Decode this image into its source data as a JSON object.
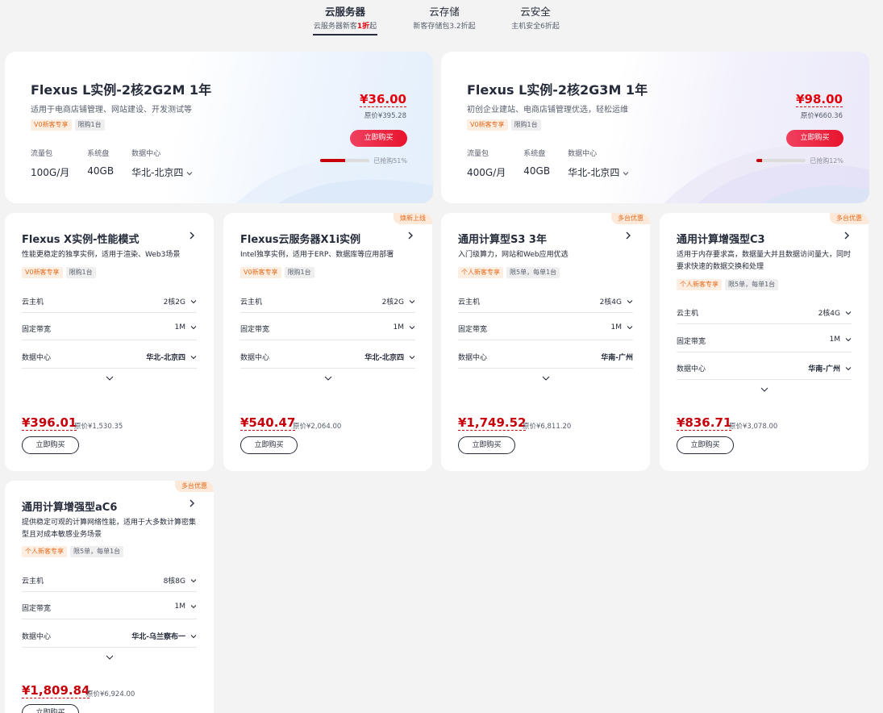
{
  "tabs": [
    {
      "title": "云服务器",
      "sub_pre": "云服务器新客",
      "sub_hl": "1折",
      "sub_post": "起"
    },
    {
      "title": "云存储",
      "sub_pre": "新客存储包3.2折起",
      "sub_hl": "",
      "sub_post": ""
    },
    {
      "title": "云安全",
      "sub_pre": "主机安全6折起",
      "sub_hl": "",
      "sub_post": ""
    }
  ],
  "featured": [
    {
      "title": "Flexus L实例-2核2G2M 1年",
      "desc": "适用于电商店铺管理、网站建设、开发测试等",
      "tags": [
        "V0新客专享",
        "限购1台"
      ],
      "specs": [
        {
          "label": "流量包",
          "value": "100G/月"
        },
        {
          "label": "系统盘",
          "value": "40GB"
        },
        {
          "label": "数据中心",
          "value": "华北-北京四"
        }
      ],
      "price": "¥36.00",
      "original": "原价¥395.28",
      "buy": "立即购买",
      "sold_label": "已抢购51%",
      "sold_percent": 51
    },
    {
      "title": "Flexus L实例-2核2G3M 1年",
      "desc": "初创企业建站、电商店铺管理优选，轻松运维",
      "tags": [
        "V0新客专享",
        "限购1台"
      ],
      "specs": [
        {
          "label": "流量包",
          "value": "400G/月"
        },
        {
          "label": "系统盘",
          "value": "40GB"
        },
        {
          "label": "数据中心",
          "value": "华北-北京四"
        }
      ],
      "price": "¥98.00",
      "original": "原价¥660.36",
      "buy": "立即购买",
      "sold_label": "已抢购12%",
      "sold_percent": 12
    }
  ],
  "cards": [
    {
      "corner": "",
      "title": "Flexus X实例-性能模式",
      "desc": "性能更稳定的独享实例，适用于渲染、Web3场景",
      "tags": [
        "V0新客专享",
        "限购1台"
      ],
      "rows": [
        {
          "label": "云主机",
          "value": "2核2G"
        },
        {
          "label": "固定带宽",
          "value": "1M"
        },
        {
          "label": "数据中心",
          "value": "华北-北京四"
        }
      ],
      "price": "¥396.01",
      "original": "原价¥1,530.35",
      "buy": "立即购买"
    },
    {
      "corner": "焕新上线",
      "title": "Flexus云服务器X1i实例",
      "desc": "Intel独享实例，适用于ERP、数据库等应用部署",
      "tags": [
        "V0新客专享",
        "限购1台"
      ],
      "rows": [
        {
          "label": "云主机",
          "value": "2核2G"
        },
        {
          "label": "固定带宽",
          "value": "1M"
        },
        {
          "label": "数据中心",
          "value": "华北-北京四"
        }
      ],
      "price": "¥540.47",
      "original": "原价¥2,064.00",
      "buy": "立即购买"
    },
    {
      "corner": "多台优惠",
      "title": "通用计算型S3 3年",
      "desc": "入门级算力，网站和Web应用优选",
      "tags": [
        "个人新客专享",
        "限5单，每单1台"
      ],
      "rows": [
        {
          "label": "云主机",
          "value": "2核4G"
        },
        {
          "label": "固定带宽",
          "value": "1M"
        },
        {
          "label": "数据中心",
          "value": "华南-广州"
        }
      ],
      "price": "¥1,749.52",
      "original": "原价¥6,811.20",
      "buy": "立即购买"
    },
    {
      "corner": "多台优惠",
      "title": "通用计算增强型C3",
      "desc": "适用于内存要求高，数据量大并且数据访问量大，同时要求快速的数据交换和处理",
      "tags": [
        "个人新客专享",
        "限5单，每单1台"
      ],
      "rows": [
        {
          "label": "云主机",
          "value": "2核4G"
        },
        {
          "label": "固定带宽",
          "value": "1M"
        },
        {
          "label": "数据中心",
          "value": "华南-广州"
        }
      ],
      "price": "¥836.71",
      "original": "原价¥3,078.00",
      "buy": "立即购买"
    },
    {
      "corner": "多台优惠",
      "title": "通用计算增强型aC6",
      "desc": "提供稳定可观的计算网络性能，适用于大多数计算密集型且对成本敏感业务场景",
      "tags": [
        "个人新客专享",
        "限5单，每单1台"
      ],
      "rows": [
        {
          "label": "云主机",
          "value": "8核8G"
        },
        {
          "label": "固定带宽",
          "value": "1M"
        },
        {
          "label": "数据中心",
          "value": "华北-乌兰察布一"
        }
      ],
      "price": "¥1,809.84",
      "original": "原价¥6,924.00",
      "buy": "立即购买"
    }
  ],
  "colors": {
    "accent_red": "#c7000b",
    "tag_orange": "#e46c1e",
    "text": "#252b3a"
  }
}
